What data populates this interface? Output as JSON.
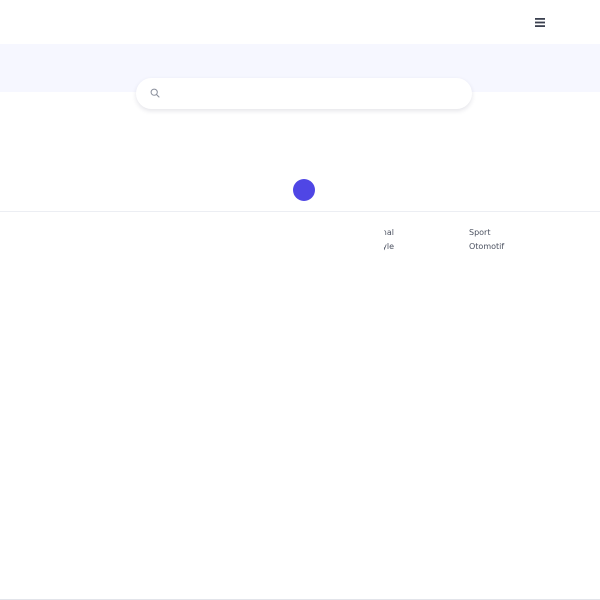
{
  "colors": {
    "accent": "#4f46e5",
    "search_band": "#f6f7ff",
    "text": "#4b5160"
  },
  "header": {
    "menu_icon": "hamburger-icon"
  },
  "search": {
    "icon": "search-icon",
    "placeholder": "",
    "value": ""
  },
  "loader": {
    "icon": "loading-spinner"
  },
  "footer": {
    "links_partial": [
      "nal",
      "yle"
    ],
    "links": [
      "Sport",
      "Otomotif"
    ]
  }
}
